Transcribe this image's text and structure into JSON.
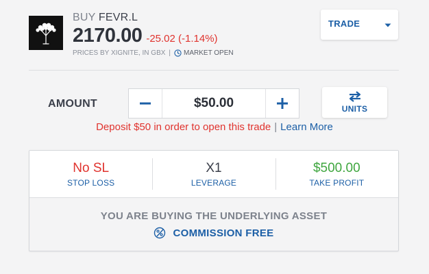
{
  "header": {
    "action": "BUY",
    "ticker": "FEVR.L",
    "price": "2170.00",
    "change": "-25.02 (-1.14%)",
    "prices_by": "PRICES BY XIGNITE, IN GBX",
    "separator": "|",
    "market_status": "MARKET OPEN",
    "logo_icon": "tree-logo-icon"
  },
  "trade_select": {
    "label": "TRADE",
    "icon": "caret-down-icon"
  },
  "amount": {
    "label": "AMOUNT",
    "value": "$50.00",
    "minus_icon": "minus-icon",
    "plus_icon": "plus-icon"
  },
  "units_button": {
    "label": "UNITS",
    "icon": "swap-arrows-icon"
  },
  "deposit": {
    "message": "Deposit $50 in order to open this trade",
    "separator": "|",
    "learn_more": "Learn More"
  },
  "order": {
    "stop_loss": {
      "value": "No SL",
      "caption": "STOP LOSS"
    },
    "leverage": {
      "value": "X1",
      "caption": "LEVERAGE"
    },
    "take_profit": {
      "value": "$500.00",
      "caption": "TAKE PROFIT"
    },
    "buying_text": "YOU ARE BUYING THE UNDERLYING ASSET",
    "commission_text": "COMMISSION FREE",
    "commission_icon": "percent-badge-icon"
  },
  "colors": {
    "accent_blue": "#1c5fa6",
    "negative_red": "#e0332e",
    "positive_green": "#3fa63f"
  }
}
